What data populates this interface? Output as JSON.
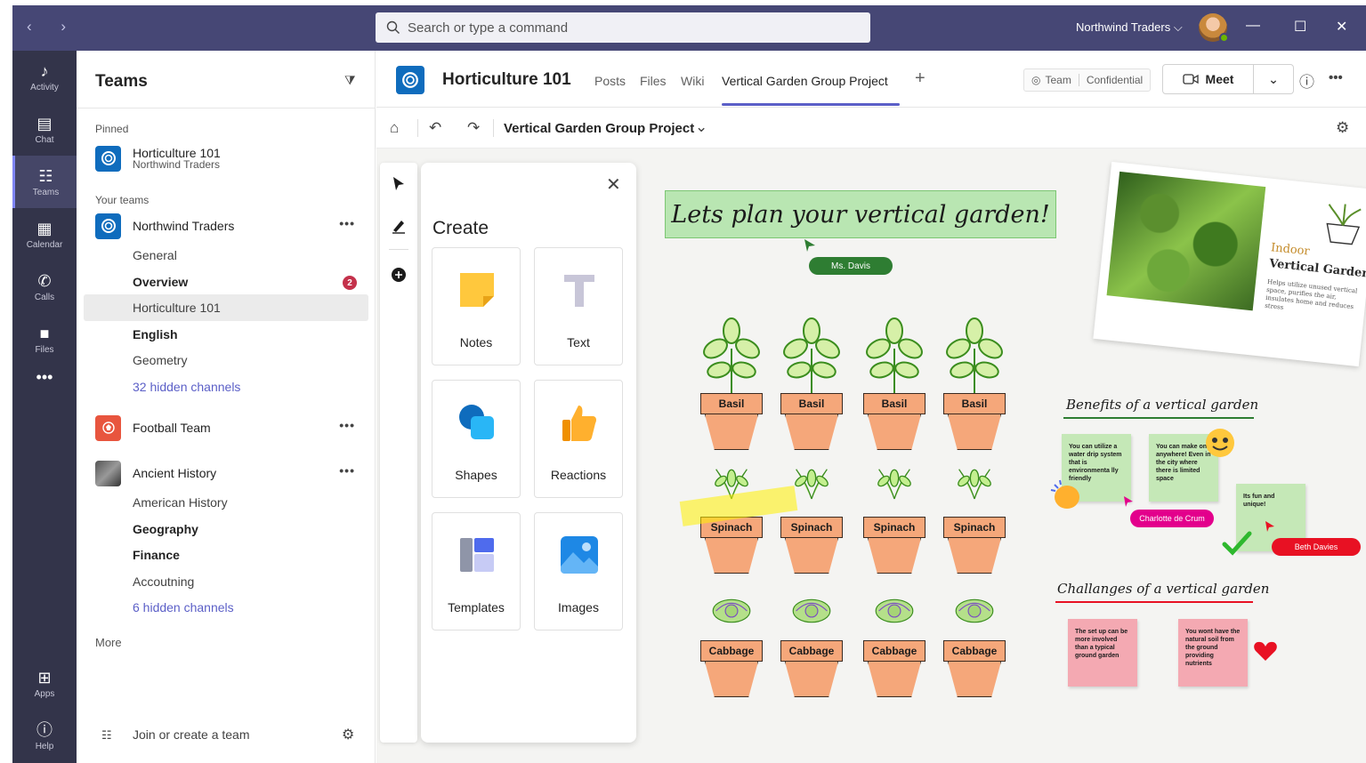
{
  "titlebar": {
    "search_placeholder": "Search or type a command",
    "org_name": "Northwind Traders ⌵",
    "minimize": "—",
    "maximize": "☐",
    "close": "✕"
  },
  "rail": [
    {
      "label": "Activity",
      "icon": "bell-icon",
      "glyph": "🔔"
    },
    {
      "label": "Chat",
      "icon": "chat-icon",
      "glyph": "💬"
    },
    {
      "label": "Teams",
      "icon": "teams-icon",
      "glyph": "👥"
    },
    {
      "label": "Calendar",
      "icon": "calendar-icon",
      "glyph": "📅"
    },
    {
      "label": "Calls",
      "icon": "phone-icon",
      "glyph": "📞"
    },
    {
      "label": "Files",
      "icon": "file-icon",
      "glyph": "📄"
    },
    {
      "label": "",
      "icon": "more-icon",
      "glyph": "•••"
    },
    {
      "label": "Apps",
      "icon": "apps-icon",
      "glyph": "⊞"
    },
    {
      "label": "Help",
      "icon": "help-icon",
      "glyph": "?"
    }
  ],
  "teams_panel": {
    "title": "Teams",
    "pinned_label": "Pinned",
    "pinned": {
      "name": "Horticulture 101",
      "sub": "Northwind Traders"
    },
    "your_teams_label": "Your teams",
    "teams": [
      {
        "name": "Northwind Traders",
        "channels": [
          {
            "name": "General",
            "style": "normal"
          },
          {
            "name": "Overview",
            "style": "bold",
            "badge": "2"
          },
          {
            "name": "Horticulture 101",
            "style": "selected"
          },
          {
            "name": "English",
            "style": "bold"
          },
          {
            "name": "Geometry",
            "style": "normal"
          },
          {
            "name": "32 hidden channels",
            "style": "link"
          }
        ]
      },
      {
        "name": "Football Team",
        "channels": []
      },
      {
        "name": "Ancient History",
        "channels": [
          {
            "name": "American History",
            "style": "normal"
          },
          {
            "name": "Geography",
            "style": "bold"
          },
          {
            "name": "Finance",
            "style": "bold"
          },
          {
            "name": "Accoutning",
            "style": "normal"
          },
          {
            "name": "6 hidden channels",
            "style": "link"
          }
        ]
      }
    ],
    "more_label": "More",
    "join_label": "Join or create a team",
    "more_dots": "•••"
  },
  "header": {
    "channel_title": "Horticulture 101",
    "tabs": [
      "Posts",
      "Files",
      "Wiki",
      "Vertical Garden Group Project"
    ],
    "add_tab": "+",
    "tag_team": "Team",
    "tag_confidential": "Confidential",
    "meet_label": "Meet",
    "info": "ⓘ",
    "more": "•••"
  },
  "wb_toolbar": {
    "title": "Vertical Garden Group Project"
  },
  "create_panel": {
    "title": "Create",
    "items": [
      {
        "label": "Notes",
        "icon": "sticky-note-icon"
      },
      {
        "label": "Text",
        "icon": "text-icon"
      },
      {
        "label": "Shapes",
        "icon": "shapes-icon"
      },
      {
        "label": "Reactions",
        "icon": "thumbs-up-icon"
      },
      {
        "label": "Templates",
        "icon": "templates-icon"
      },
      {
        "label": "Images",
        "icon": "images-icon"
      }
    ]
  },
  "whiteboard": {
    "headline": "Lets plan your vertical garden!",
    "cursor_ms_davis": "Ms. Davis",
    "cursor_charlotte": "Charlotte de Crum",
    "cursor_beth": "Beth Davies",
    "pots_row1": [
      "Basil",
      "Basil",
      "Basil",
      "Basil"
    ],
    "pots_row2": [
      "Spinach",
      "Spinach",
      "Spinach",
      "Spinach"
    ],
    "pots_row3": [
      "Cabbage",
      "Cabbage",
      "Cabbage",
      "Cabbage"
    ],
    "benefits_title": "Benefits of a vertical garden",
    "benefits_notes": [
      "You can utilize a water drip system that is environmenta lly friendly",
      "You can make one anywhere! Even in the city where there is limited space",
      "Its fun and unique!"
    ],
    "challenges_title": "Challanges of a vertical garden",
    "challenges_notes": [
      "The set up can be more involved than a typical ground garden",
      "You wont have the natural soil from the ground providing nutrients"
    ],
    "photo_card": {
      "title1": "Indoor",
      "title2": "Vertical Gardens",
      "desc": "Helps utilize unused vertical space, purifies the air, insulates home and reduces stress"
    }
  },
  "colors": {
    "titlebar": "#464775",
    "rail": "#33344a",
    "accent": "#5b5fc7",
    "badge": "#c4314b",
    "cursor_green": "#2e7d32",
    "cursor_pink": "#e3008c",
    "cursor_red": "#e81123"
  }
}
